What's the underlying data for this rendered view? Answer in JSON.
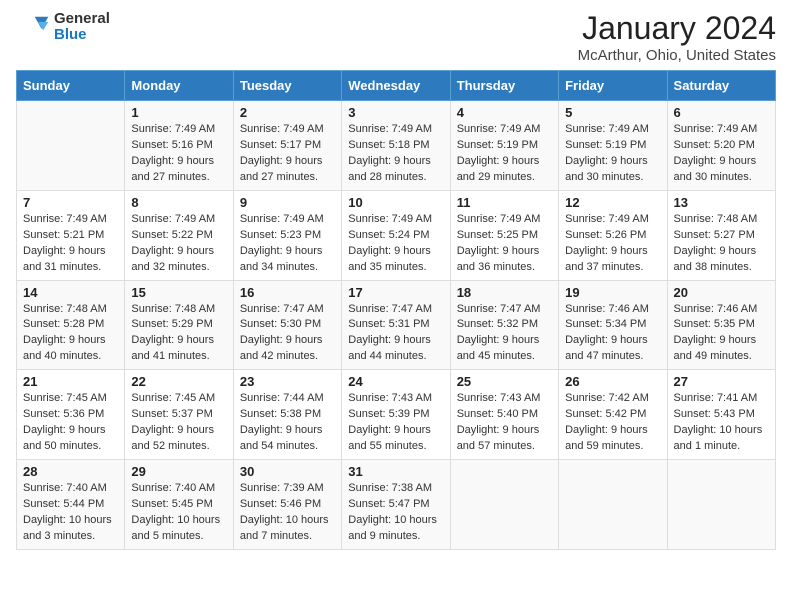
{
  "logo": {
    "line1": "General",
    "line2": "Blue"
  },
  "title": "January 2024",
  "subtitle": "McArthur, Ohio, United States",
  "days_of_week": [
    "Sunday",
    "Monday",
    "Tuesday",
    "Wednesday",
    "Thursday",
    "Friday",
    "Saturday"
  ],
  "weeks": [
    [
      {
        "day": "",
        "sunrise": "",
        "sunset": "",
        "daylight": ""
      },
      {
        "day": "1",
        "sunrise": "Sunrise: 7:49 AM",
        "sunset": "Sunset: 5:16 PM",
        "daylight": "Daylight: 9 hours and 27 minutes."
      },
      {
        "day": "2",
        "sunrise": "Sunrise: 7:49 AM",
        "sunset": "Sunset: 5:17 PM",
        "daylight": "Daylight: 9 hours and 27 minutes."
      },
      {
        "day": "3",
        "sunrise": "Sunrise: 7:49 AM",
        "sunset": "Sunset: 5:18 PM",
        "daylight": "Daylight: 9 hours and 28 minutes."
      },
      {
        "day": "4",
        "sunrise": "Sunrise: 7:49 AM",
        "sunset": "Sunset: 5:19 PM",
        "daylight": "Daylight: 9 hours and 29 minutes."
      },
      {
        "day": "5",
        "sunrise": "Sunrise: 7:49 AM",
        "sunset": "Sunset: 5:19 PM",
        "daylight": "Daylight: 9 hours and 30 minutes."
      },
      {
        "day": "6",
        "sunrise": "Sunrise: 7:49 AM",
        "sunset": "Sunset: 5:20 PM",
        "daylight": "Daylight: 9 hours and 30 minutes."
      }
    ],
    [
      {
        "day": "7",
        "sunrise": "Sunrise: 7:49 AM",
        "sunset": "Sunset: 5:21 PM",
        "daylight": "Daylight: 9 hours and 31 minutes."
      },
      {
        "day": "8",
        "sunrise": "Sunrise: 7:49 AM",
        "sunset": "Sunset: 5:22 PM",
        "daylight": "Daylight: 9 hours and 32 minutes."
      },
      {
        "day": "9",
        "sunrise": "Sunrise: 7:49 AM",
        "sunset": "Sunset: 5:23 PM",
        "daylight": "Daylight: 9 hours and 34 minutes."
      },
      {
        "day": "10",
        "sunrise": "Sunrise: 7:49 AM",
        "sunset": "Sunset: 5:24 PM",
        "daylight": "Daylight: 9 hours and 35 minutes."
      },
      {
        "day": "11",
        "sunrise": "Sunrise: 7:49 AM",
        "sunset": "Sunset: 5:25 PM",
        "daylight": "Daylight: 9 hours and 36 minutes."
      },
      {
        "day": "12",
        "sunrise": "Sunrise: 7:49 AM",
        "sunset": "Sunset: 5:26 PM",
        "daylight": "Daylight: 9 hours and 37 minutes."
      },
      {
        "day": "13",
        "sunrise": "Sunrise: 7:48 AM",
        "sunset": "Sunset: 5:27 PM",
        "daylight": "Daylight: 9 hours and 38 minutes."
      }
    ],
    [
      {
        "day": "14",
        "sunrise": "Sunrise: 7:48 AM",
        "sunset": "Sunset: 5:28 PM",
        "daylight": "Daylight: 9 hours and 40 minutes."
      },
      {
        "day": "15",
        "sunrise": "Sunrise: 7:48 AM",
        "sunset": "Sunset: 5:29 PM",
        "daylight": "Daylight: 9 hours and 41 minutes."
      },
      {
        "day": "16",
        "sunrise": "Sunrise: 7:47 AM",
        "sunset": "Sunset: 5:30 PM",
        "daylight": "Daylight: 9 hours and 42 minutes."
      },
      {
        "day": "17",
        "sunrise": "Sunrise: 7:47 AM",
        "sunset": "Sunset: 5:31 PM",
        "daylight": "Daylight: 9 hours and 44 minutes."
      },
      {
        "day": "18",
        "sunrise": "Sunrise: 7:47 AM",
        "sunset": "Sunset: 5:32 PM",
        "daylight": "Daylight: 9 hours and 45 minutes."
      },
      {
        "day": "19",
        "sunrise": "Sunrise: 7:46 AM",
        "sunset": "Sunset: 5:34 PM",
        "daylight": "Daylight: 9 hours and 47 minutes."
      },
      {
        "day": "20",
        "sunrise": "Sunrise: 7:46 AM",
        "sunset": "Sunset: 5:35 PM",
        "daylight": "Daylight: 9 hours and 49 minutes."
      }
    ],
    [
      {
        "day": "21",
        "sunrise": "Sunrise: 7:45 AM",
        "sunset": "Sunset: 5:36 PM",
        "daylight": "Daylight: 9 hours and 50 minutes."
      },
      {
        "day": "22",
        "sunrise": "Sunrise: 7:45 AM",
        "sunset": "Sunset: 5:37 PM",
        "daylight": "Daylight: 9 hours and 52 minutes."
      },
      {
        "day": "23",
        "sunrise": "Sunrise: 7:44 AM",
        "sunset": "Sunset: 5:38 PM",
        "daylight": "Daylight: 9 hours and 54 minutes."
      },
      {
        "day": "24",
        "sunrise": "Sunrise: 7:43 AM",
        "sunset": "Sunset: 5:39 PM",
        "daylight": "Daylight: 9 hours and 55 minutes."
      },
      {
        "day": "25",
        "sunrise": "Sunrise: 7:43 AM",
        "sunset": "Sunset: 5:40 PM",
        "daylight": "Daylight: 9 hours and 57 minutes."
      },
      {
        "day": "26",
        "sunrise": "Sunrise: 7:42 AM",
        "sunset": "Sunset: 5:42 PM",
        "daylight": "Daylight: 9 hours and 59 minutes."
      },
      {
        "day": "27",
        "sunrise": "Sunrise: 7:41 AM",
        "sunset": "Sunset: 5:43 PM",
        "daylight": "Daylight: 10 hours and 1 minute."
      }
    ],
    [
      {
        "day": "28",
        "sunrise": "Sunrise: 7:40 AM",
        "sunset": "Sunset: 5:44 PM",
        "daylight": "Daylight: 10 hours and 3 minutes."
      },
      {
        "day": "29",
        "sunrise": "Sunrise: 7:40 AM",
        "sunset": "Sunset: 5:45 PM",
        "daylight": "Daylight: 10 hours and 5 minutes."
      },
      {
        "day": "30",
        "sunrise": "Sunrise: 7:39 AM",
        "sunset": "Sunset: 5:46 PM",
        "daylight": "Daylight: 10 hours and 7 minutes."
      },
      {
        "day": "31",
        "sunrise": "Sunrise: 7:38 AM",
        "sunset": "Sunset: 5:47 PM",
        "daylight": "Daylight: 10 hours and 9 minutes."
      },
      {
        "day": "",
        "sunrise": "",
        "sunset": "",
        "daylight": ""
      },
      {
        "day": "",
        "sunrise": "",
        "sunset": "",
        "daylight": ""
      },
      {
        "day": "",
        "sunrise": "",
        "sunset": "",
        "daylight": ""
      }
    ]
  ]
}
